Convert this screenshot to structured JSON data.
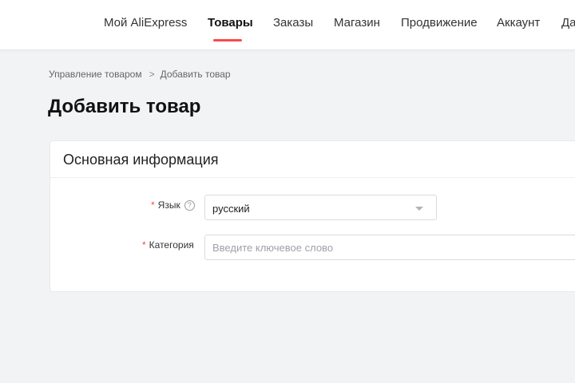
{
  "nav": {
    "items": [
      {
        "label": "Мой AliExpress",
        "active": false
      },
      {
        "label": "Товары",
        "active": true
      },
      {
        "label": "Заказы",
        "active": false
      },
      {
        "label": "Магазин",
        "active": false
      },
      {
        "label": "Продвижение",
        "active": false
      },
      {
        "label": "Аккаунт",
        "active": false
      },
      {
        "label": "Да",
        "active": false
      }
    ],
    "active_underline_color": "#ff4747"
  },
  "breadcrumb": {
    "parent": "Управление товаром",
    "separator": ">",
    "current": "Добавить товар"
  },
  "page": {
    "title": "Добавить товар"
  },
  "card": {
    "title": "Основная информация",
    "fields": {
      "language": {
        "required_mark": "*",
        "label": "Язык",
        "help_icon": "?",
        "value": "русский"
      },
      "category": {
        "required_mark": "*",
        "label": "Категория",
        "placeholder": "Введите ключевое слово",
        "value": ""
      }
    }
  },
  "colors": {
    "accent": "#ff4747",
    "background": "#f2f3f5"
  },
  "icons": {
    "breadcrumb_separator": "chevron-right-icon",
    "help": "question-circle-icon",
    "select_caret": "caret-down-icon"
  }
}
